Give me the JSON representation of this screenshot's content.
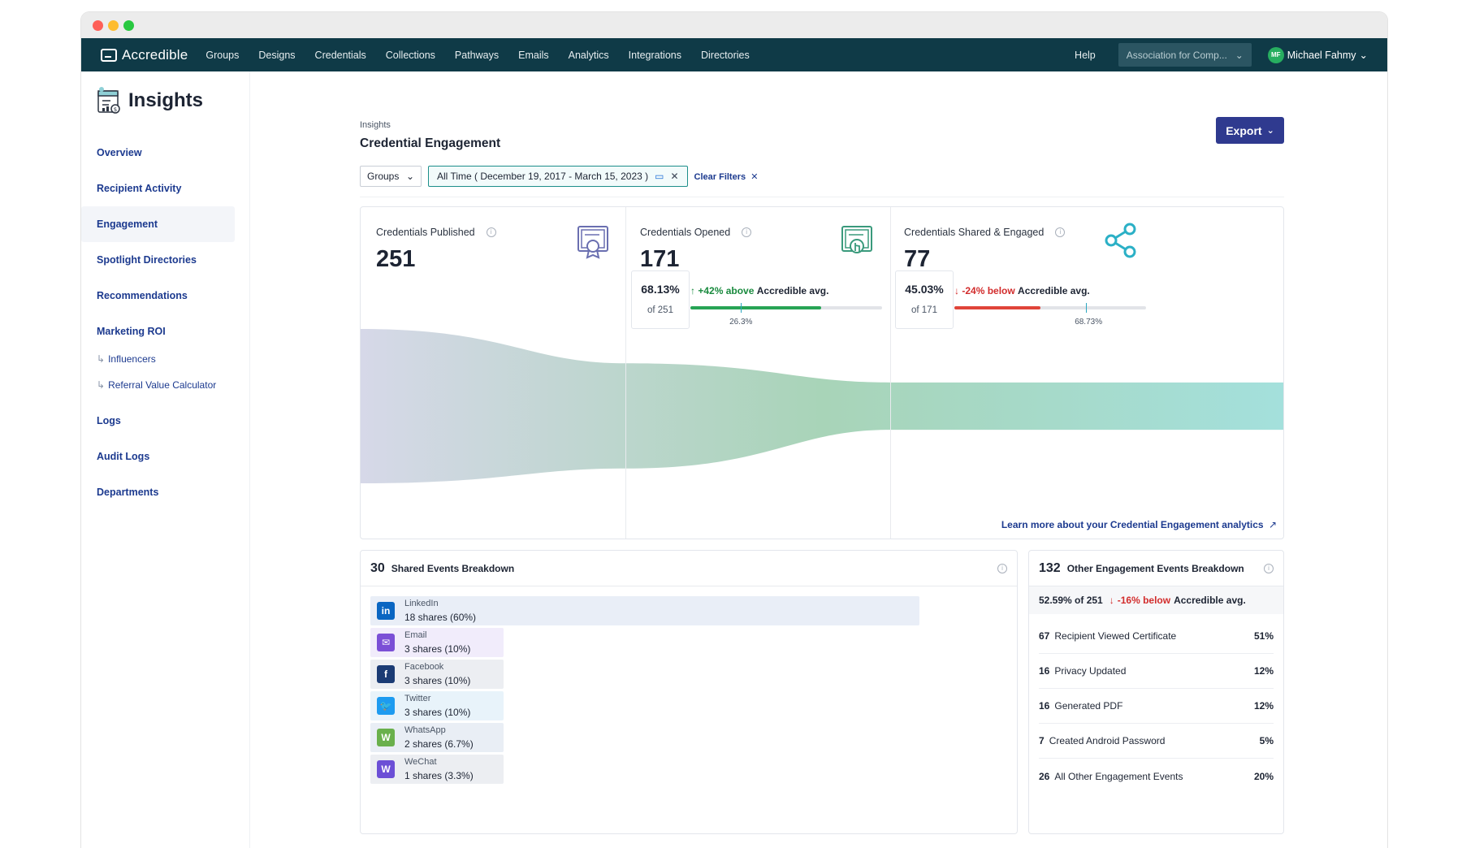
{
  "nav": {
    "brand": "Accredible",
    "links": [
      "Groups",
      "Designs",
      "Credentials",
      "Collections",
      "Pathways",
      "Emails",
      "Analytics",
      "Integrations",
      "Directories"
    ],
    "help": "Help",
    "org": "Association for Comp...",
    "user_initials": "MF",
    "user_name": "Michael Fahmy"
  },
  "sidebar": {
    "title": "Insights",
    "items": [
      {
        "label": "Overview"
      },
      {
        "label": "Recipient Activity"
      },
      {
        "label": "Engagement"
      },
      {
        "label": "Spotlight Directories"
      },
      {
        "label": "Recommendations"
      },
      {
        "label": "Marketing ROI"
      }
    ],
    "sub_items": [
      {
        "label": "Influencers"
      },
      {
        "label": "Referral Value Calculator"
      }
    ],
    "bottom_items": [
      {
        "label": "Logs"
      },
      {
        "label": "Audit Logs"
      },
      {
        "label": "Departments"
      }
    ]
  },
  "header": {
    "breadcrumb": "Insights",
    "title": "Credential Engagement",
    "export": "Export"
  },
  "filters": {
    "groups": "Groups",
    "date_range": "All Time ( December 19, 2017 - March 15, 2023 )",
    "clear": "Clear Filters"
  },
  "funnel": {
    "published": {
      "label": "Credentials Published",
      "value": "251"
    },
    "opened": {
      "label": "Credentials Opened",
      "value": "171",
      "pct": "68.13%",
      "of": "of 251",
      "delta": "+42% above",
      "delta_suffix": "Accredible avg.",
      "avg_label": "26.3%",
      "fill_fraction": 0.6813,
      "avg_fraction": 0.263
    },
    "shared": {
      "label": "Credentials Shared & Engaged",
      "value": "77",
      "pct": "45.03%",
      "of": "of 171",
      "delta": "-24% below",
      "delta_suffix": "Accredible avg.",
      "avg_label": "68.73%",
      "fill_fraction": 0.4503,
      "avg_fraction": 0.6873
    },
    "learn_more": "Learn more about your Credential Engagement analytics",
    "colors": {
      "start": "#d6d8e8",
      "middle": "#a8d4b8",
      "end": "#a4e0dc"
    }
  },
  "shared_events": {
    "count": "30",
    "title": "Shared Events Breakdown",
    "rows": [
      {
        "name": "LinkedIn",
        "shares": "18 shares (60%)",
        "fraction": 0.6,
        "icon": "linkedin-icon",
        "glyph": "in",
        "color": "#0a66c2",
        "bg": "#e9eef7"
      },
      {
        "name": "Email",
        "shares": "3 shares (10%)",
        "fraction": 0.1,
        "icon": "email-icon",
        "glyph": "✉",
        "color": "#7b4fd6",
        "bg": "#f1ecfb"
      },
      {
        "name": "Facebook",
        "shares": "3 shares (10%)",
        "fraction": 0.1,
        "icon": "facebook-icon",
        "glyph": "f",
        "color": "#1b3b74",
        "bg": "#eceef2"
      },
      {
        "name": "Twitter",
        "shares": "3 shares (10%)",
        "fraction": 0.1,
        "icon": "twitter-icon",
        "glyph": "🐦",
        "color": "#1d9bf0",
        "bg": "#e8f3fa"
      },
      {
        "name": "WhatsApp",
        "shares": "2 shares (6.7%)",
        "fraction": 0.067,
        "icon": "whatsapp-icon",
        "glyph": "W",
        "color": "#6ab04c",
        "bg": "#e9eef5"
      },
      {
        "name": "WeChat",
        "shares": "1 shares (3.3%)",
        "fraction": 0.033,
        "icon": "wechat-icon",
        "glyph": "W",
        "color": "#6c4fd6",
        "bg": "#eceef2"
      }
    ]
  },
  "other_events": {
    "count": "132",
    "title": "Other Engagement Events Breakdown",
    "pct_text": "52.59% of 251",
    "delta": "-16% below",
    "delta_suffix": "Accredible avg.",
    "rows": [
      {
        "n": "67",
        "label": "Recipient Viewed Certificate",
        "pct": "51%"
      },
      {
        "n": "16",
        "label": "Privacy Updated",
        "pct": "12%"
      },
      {
        "n": "16",
        "label": "Generated PDF",
        "pct": "12%"
      },
      {
        "n": "7",
        "label": "Created Android Password",
        "pct": "5%"
      },
      {
        "n": "26",
        "label": "All Other Engagement Events",
        "pct": "20%"
      }
    ]
  }
}
